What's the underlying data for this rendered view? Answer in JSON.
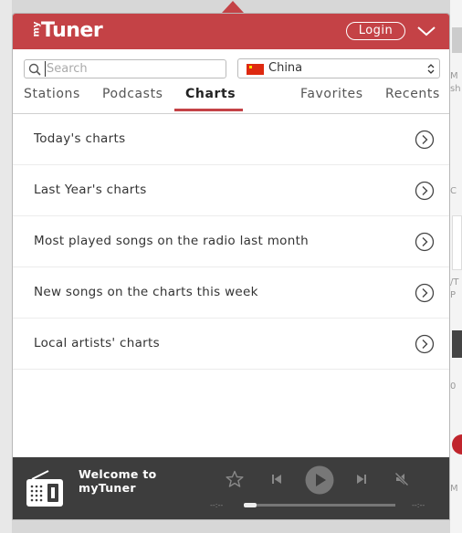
{
  "app": {
    "brand_prefix": "my",
    "brand_name": "Tuner",
    "login_label": "Login"
  },
  "search": {
    "placeholder": "Search",
    "value": ""
  },
  "country": {
    "selected": "China"
  },
  "tabs": [
    {
      "label": "Stations"
    },
    {
      "label": "Podcasts"
    },
    {
      "label": "Charts",
      "active": true
    },
    {
      "label": "Favorites"
    },
    {
      "label": "Recents"
    }
  ],
  "charts": [
    {
      "label": "Today's charts"
    },
    {
      "label": "Last Year's charts"
    },
    {
      "label": "Most played songs on the radio last month"
    },
    {
      "label": "New songs on the charts this week"
    },
    {
      "label": "Local artists' charts"
    }
  ],
  "player": {
    "title_line1": "Welcome to",
    "title_line2": "myTuner",
    "time_elapsed": "--:--",
    "time_total": "--:--",
    "progress": 0
  },
  "background": {
    "fragments": [
      "M",
      "sh",
      "C",
      "/T",
      "P",
      "0",
      "M"
    ]
  },
  "colors": {
    "brand_red": "#c44246",
    "player_bg": "#3d3d3d"
  },
  "icons": {
    "search": "magnifier",
    "dropdown": "chevron-down",
    "list_item": "chevron-right-circle",
    "favorite": "star-outline",
    "previous": "skip-previous",
    "play": "play",
    "next": "skip-next",
    "mute": "speaker-muted",
    "radio": "radio"
  }
}
